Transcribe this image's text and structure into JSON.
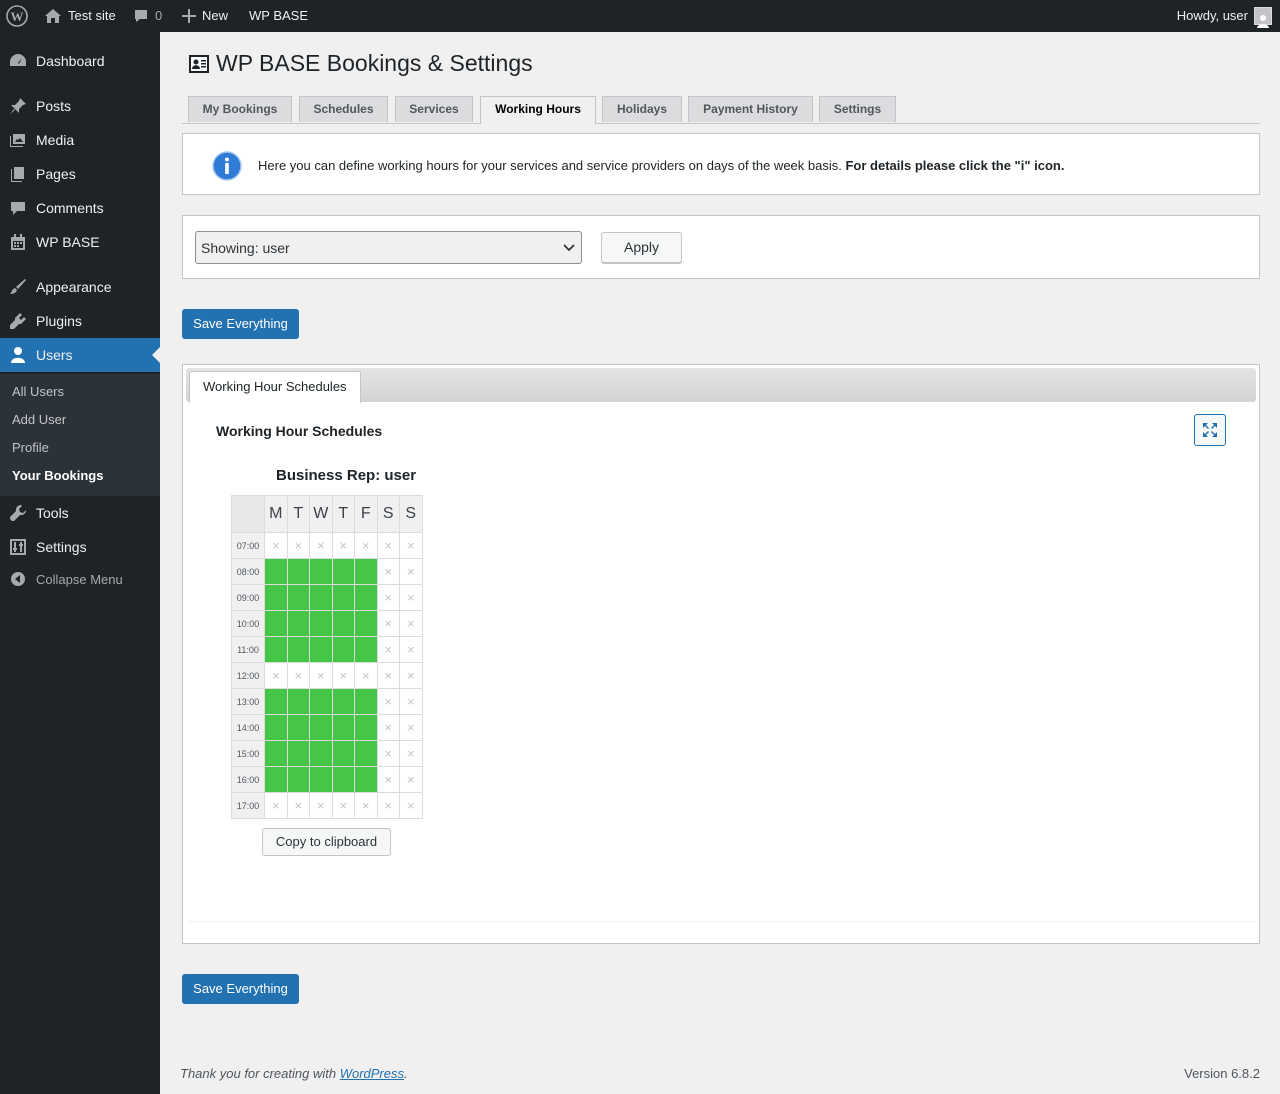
{
  "adminbar": {
    "site_name": "Test site",
    "comments_count": "0",
    "new_label": "New",
    "plugin_label": "WP BASE",
    "howdy": "Howdy, user"
  },
  "sidebar": {
    "items": [
      {
        "label": "Dashboard",
        "icon": "dashboard-icon"
      },
      {
        "label": "Posts",
        "icon": "pin-icon"
      },
      {
        "label": "Media",
        "icon": "media-icon"
      },
      {
        "label": "Pages",
        "icon": "pages-icon"
      },
      {
        "label": "Comments",
        "icon": "comment-icon"
      },
      {
        "label": "WP BASE",
        "icon": "calendar-icon"
      },
      {
        "label": "Appearance",
        "icon": "brush-icon"
      },
      {
        "label": "Plugins",
        "icon": "plug-icon"
      },
      {
        "label": "Users",
        "icon": "user-icon"
      },
      {
        "label": "Tools",
        "icon": "wrench-icon"
      },
      {
        "label": "Settings",
        "icon": "sliders-icon"
      },
      {
        "label": "Collapse Menu",
        "icon": "collapse-icon"
      }
    ],
    "submenu": [
      "All Users",
      "Add User",
      "Profile",
      "Your Bookings"
    ]
  },
  "page": {
    "title": "WP BASE Bookings & Settings",
    "tabs": [
      "My Bookings",
      "Schedules",
      "Services",
      "Working Hours",
      "Holidays",
      "Payment History",
      "Settings"
    ],
    "active_tab": "Working Hours",
    "info_text": "Here you can define working hours for your services and service providers on days of the week basis.",
    "info_bold": "For details please click the \"i\" icon.",
    "select_value": "Showing: user",
    "apply_label": "Apply",
    "save_label": "Save Everything",
    "panel_tab": "Working Hour Schedules",
    "section_title": "Working Hour Schedules",
    "schedule_title": "Business Rep: user",
    "days": [
      "M",
      "T",
      "W",
      "T",
      "F",
      "S",
      "S"
    ],
    "times": [
      "07:00",
      "08:00",
      "09:00",
      "10:00",
      "11:00",
      "12:00",
      "13:00",
      "14:00",
      "15:00",
      "16:00",
      "17:00"
    ],
    "working": [
      [
        0,
        0,
        0,
        0,
        0,
        0,
        0
      ],
      [
        1,
        1,
        1,
        1,
        1,
        0,
        0
      ],
      [
        1,
        1,
        1,
        1,
        1,
        0,
        0
      ],
      [
        1,
        1,
        1,
        1,
        1,
        0,
        0
      ],
      [
        1,
        1,
        1,
        1,
        1,
        0,
        0
      ],
      [
        0,
        0,
        0,
        0,
        0,
        0,
        0
      ],
      [
        1,
        1,
        1,
        1,
        1,
        0,
        0
      ],
      [
        1,
        1,
        1,
        1,
        1,
        0,
        0
      ],
      [
        1,
        1,
        1,
        1,
        1,
        0,
        0
      ],
      [
        1,
        1,
        1,
        1,
        1,
        0,
        0
      ],
      [
        0,
        0,
        0,
        0,
        0,
        0,
        0
      ]
    ],
    "off_glyph": "×",
    "copy_label": "Copy to clipboard",
    "working_color": "#46c646"
  },
  "footer": {
    "thanks_prefix": "Thank you for creating with",
    "wp_link": "WordPress",
    "thanks_suffix": ".",
    "version": "Version 6.8.2"
  }
}
